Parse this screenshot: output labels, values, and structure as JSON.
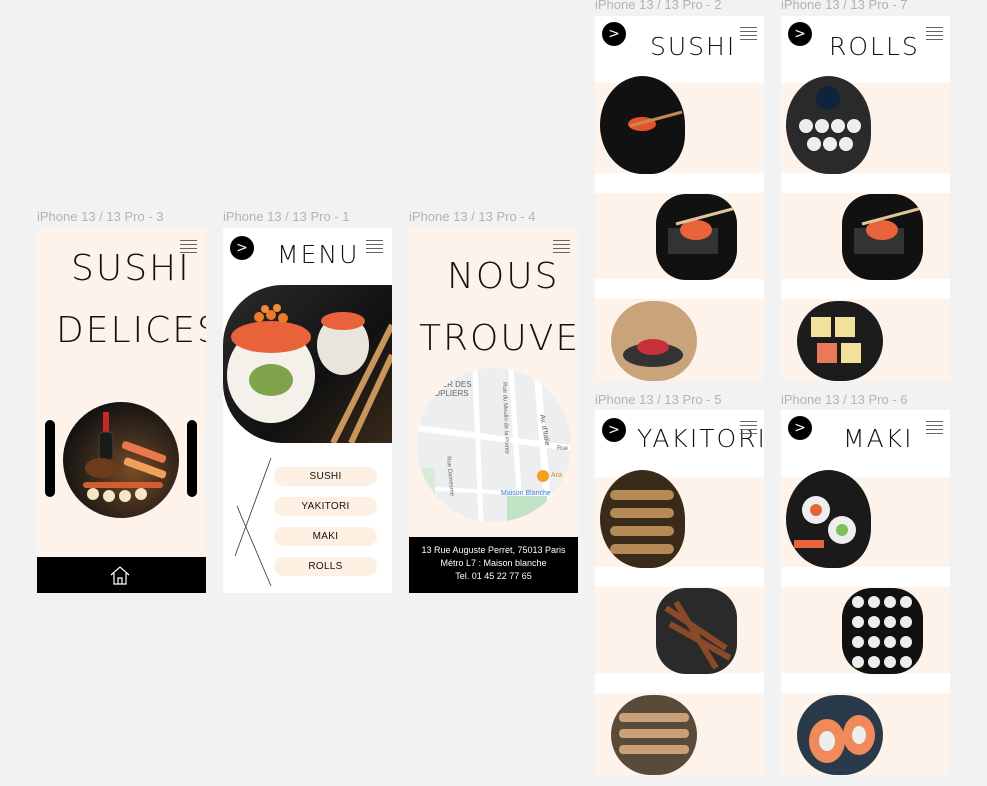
{
  "frames": {
    "home": {
      "label": "iPhone 13 / 13 Pro - 3",
      "title_line1": "SUSHI",
      "title_line2": "DELICES"
    },
    "menu": {
      "label": "iPhone 13 / 13 Pro - 1",
      "title": "MENU",
      "items": [
        "SUSHI",
        "YAKITORI",
        "MAKI",
        "ROLLS"
      ]
    },
    "find": {
      "label": "iPhone 13 / 13 Pro - 4",
      "title_line1": "NOUS",
      "title_line2": "TROUVER",
      "map_labels": {
        "district": "RTIER DES\nEUPLIERS",
        "street1": "Rue Damesme",
        "street2": "Rue du Moulin de la Pointe",
        "street3": "Av. d'Italie",
        "street4": "Rue",
        "poi": "Ara",
        "metro": "Maison Blanche"
      },
      "address": "13 Rue Auguste Perret, 75013 Paris",
      "metro": "Métro L7 : Maison blanche",
      "phone": "Tel. 01 45 22 77 65"
    },
    "sushi": {
      "label": "iPhone 13 / 13 Pro - 2",
      "title": "SUSHI"
    },
    "rolls": {
      "label": "iPhone 13 / 13 Pro - 7",
      "title": "ROLLS"
    },
    "yakitori": {
      "label": "iPhone 13 / 13 Pro - 5",
      "title": "YAKITORI"
    },
    "maki": {
      "label": "iPhone 13 / 13 Pro - 6",
      "title": "MAKI"
    }
  },
  "icons": {
    "back": "chevron-right-icon",
    "menu": "hamburger-icon",
    "home": "home-icon"
  },
  "colors": {
    "cream": "#fdf3ea",
    "black": "#000000",
    "canvas": "#f2f2f2"
  }
}
